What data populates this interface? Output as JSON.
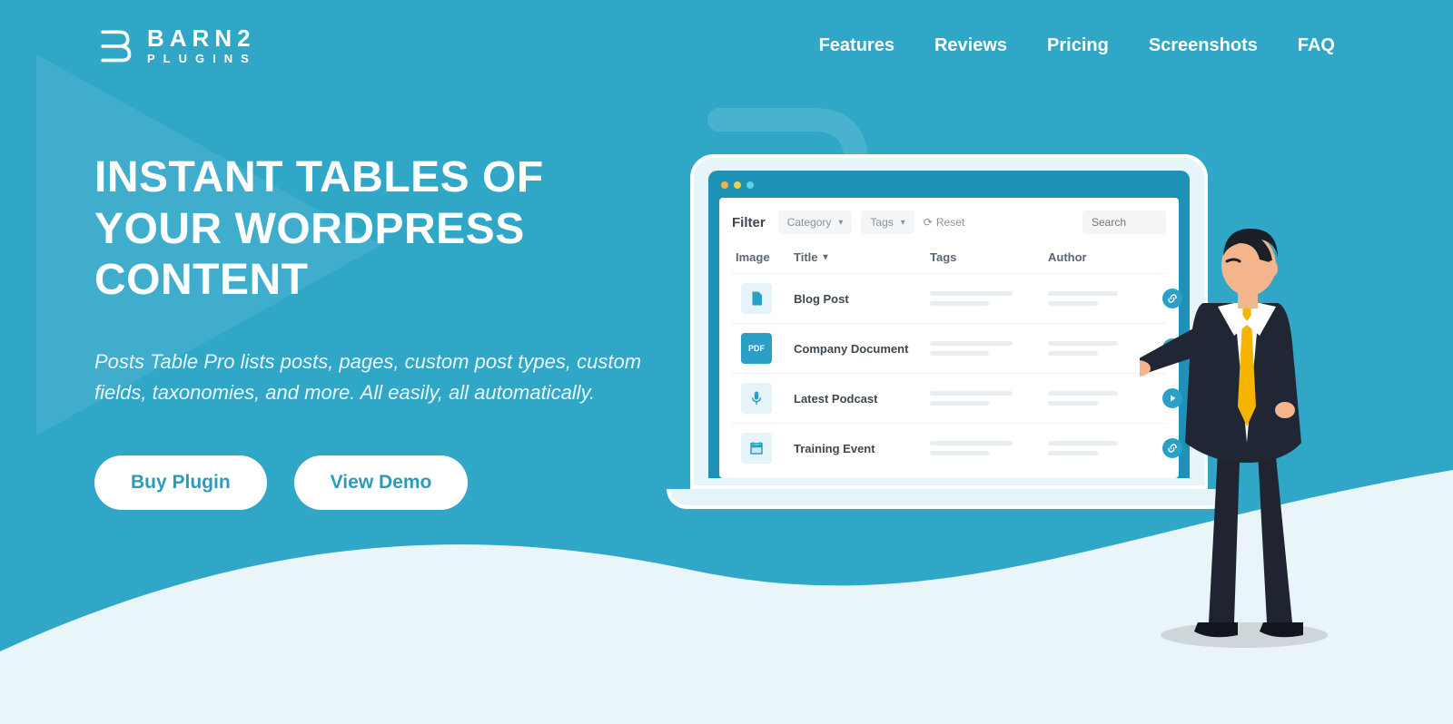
{
  "brand": {
    "name": "BARN2",
    "sub": "PLUGINS"
  },
  "nav": {
    "features": "Features",
    "reviews": "Reviews",
    "pricing": "Pricing",
    "screenshots": "Screenshots",
    "faq": "FAQ"
  },
  "hero": {
    "title": "INSTANT TABLES OF YOUR WORDPRESS CONTENT",
    "subtitle": "Posts Table Pro lists posts, pages, custom post types, custom fields, taxonomies, and more. All easily, all automatically.",
    "buy": "Buy Plugin",
    "demo": "View Demo"
  },
  "mockup": {
    "filter_label": "Filter",
    "category_label": "Category",
    "tags_label": "Tags",
    "reset_label": "Reset",
    "search_placeholder": "Search",
    "columns": {
      "image": "Image",
      "title": "Title",
      "tags": "Tags",
      "author": "Author"
    },
    "rows": [
      {
        "title": "Blog Post",
        "icon": "doc",
        "action": "link"
      },
      {
        "title": "Company Document",
        "icon": "pdf",
        "action": "download"
      },
      {
        "title": "Latest Podcast",
        "icon": "mic",
        "action": "play"
      },
      {
        "title": "Training Event",
        "icon": "calendar",
        "action": "link"
      }
    ]
  },
  "colors": {
    "primary": "#30a7c7",
    "accent": "#2aa0c6",
    "button_text": "#2a9bbc"
  }
}
